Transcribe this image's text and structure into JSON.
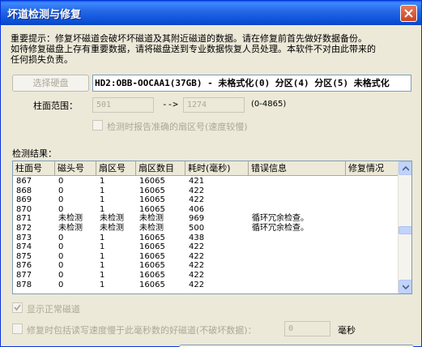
{
  "window": {
    "title": "坏道检测与修复"
  },
  "notice": {
    "line1": "重要提示：修复坏磁道会破坏坏磁道及其附近磁道的数据。请在修复前首先做好数据备份。",
    "line2": "如待修复磁盘上存有重要数据，请将磁盘送到专业数据恢复人员处理。本软件不对由此带来的",
    "line3": "任何损失负责。"
  },
  "select_disk_label": "选择硬盘",
  "disk_info": "HD2:OBB-OOCAA1(37GB) - 未格式化(0) 分区(4) 分区(5) 未格式化",
  "range": {
    "label": "柱面范围：",
    "start": "501",
    "arrow": "-->",
    "end": "1274",
    "hint": "(0-4865)"
  },
  "accurate_label": "检测时报告准确的扇区号(速度较慢)",
  "results_label": "检测结果：",
  "columns": [
    "柱面号",
    "磁头号",
    "扇区号",
    "扇区数目",
    "耗时(毫秒)",
    "错误信息",
    "修复情况"
  ],
  "rows": [
    [
      "867",
      "0",
      "1",
      "16065",
      "421",
      "",
      ""
    ],
    [
      "868",
      "0",
      "1",
      "16065",
      "422",
      "",
      ""
    ],
    [
      "869",
      "0",
      "1",
      "16065",
      "422",
      "",
      ""
    ],
    [
      "870",
      "0",
      "1",
      "16065",
      "406",
      "",
      ""
    ],
    [
      "871",
      "未检测",
      "未检测",
      "未检测",
      "969",
      "循环冗余检查。",
      ""
    ],
    [
      "872",
      "未检测",
      "未检测",
      "未检测",
      "500",
      "循环冗余检查。",
      ""
    ],
    [
      "873",
      "0",
      "1",
      "16065",
      "438",
      "",
      ""
    ],
    [
      "874",
      "0",
      "1",
      "16065",
      "422",
      "",
      ""
    ],
    [
      "875",
      "0",
      "1",
      "16065",
      "422",
      "",
      ""
    ],
    [
      "876",
      "0",
      "1",
      "16065",
      "422",
      "",
      ""
    ],
    [
      "877",
      "0",
      "1",
      "16065",
      "422",
      "",
      ""
    ],
    [
      "878",
      "0",
      "1",
      "16065",
      "422",
      "",
      ""
    ]
  ],
  "show_normal_label": "显示正常磁道",
  "slow_repair_label": "修复时包括读写速度慢于此毫秒数的好磁道(不破坏数据)：",
  "ms_value": "0",
  "ms_unit": "毫秒"
}
